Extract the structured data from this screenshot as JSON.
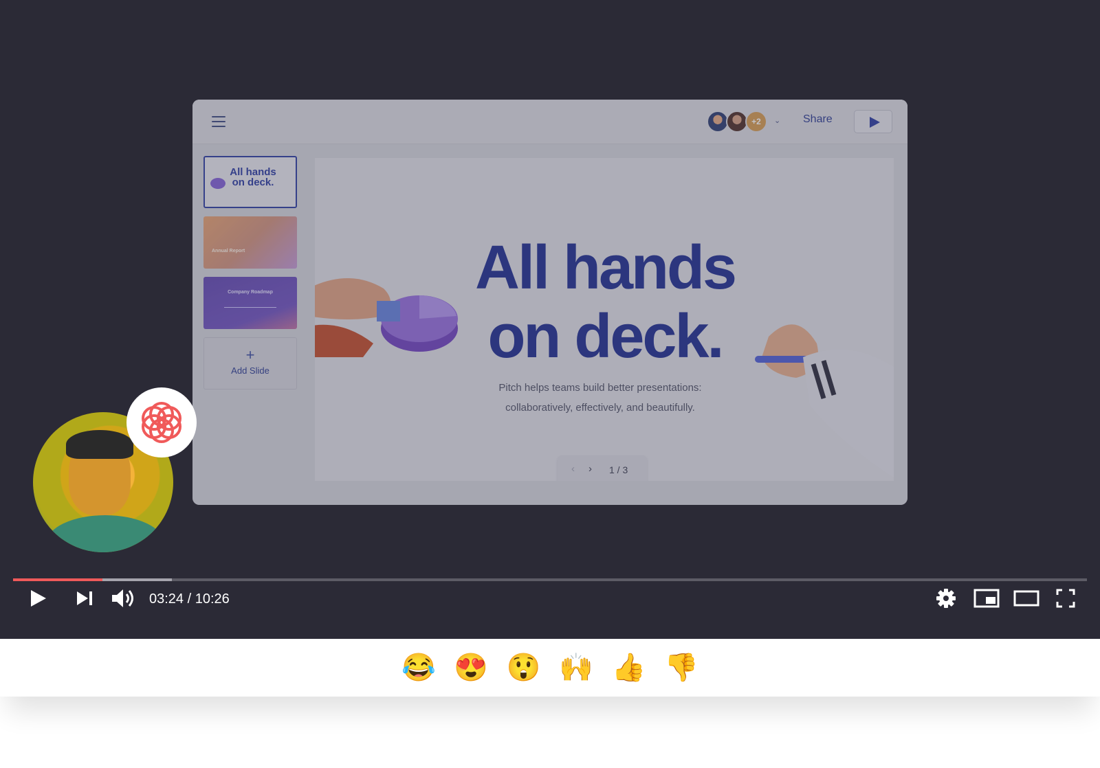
{
  "app": {
    "share_label": "Share",
    "collaborators_more": "+2"
  },
  "thumbnails": [
    {
      "title": "All hands on deck."
    },
    {
      "title": "Annual Report"
    },
    {
      "title": "Company Roadmap"
    }
  ],
  "add_slide_label": "Add Slide",
  "slide": {
    "title_line1": "All hands",
    "title_line2": "on deck.",
    "subtitle_line1": "Pitch helps teams build better presentations:",
    "subtitle_line2": "collaboratively, effectively, and beautifully."
  },
  "pager": {
    "page_label": "1 / 3"
  },
  "player": {
    "time_display": "03:24 / 10:26",
    "played_fraction": 0.083,
    "buffered_fraction": 0.148
  },
  "reactions": [
    "😂",
    "😍",
    "😲",
    "🙌",
    "👍",
    "👎"
  ],
  "colors": {
    "accent": "#f05a5a",
    "brand": "#2f3c98",
    "player_bg": "#2b2a36"
  }
}
